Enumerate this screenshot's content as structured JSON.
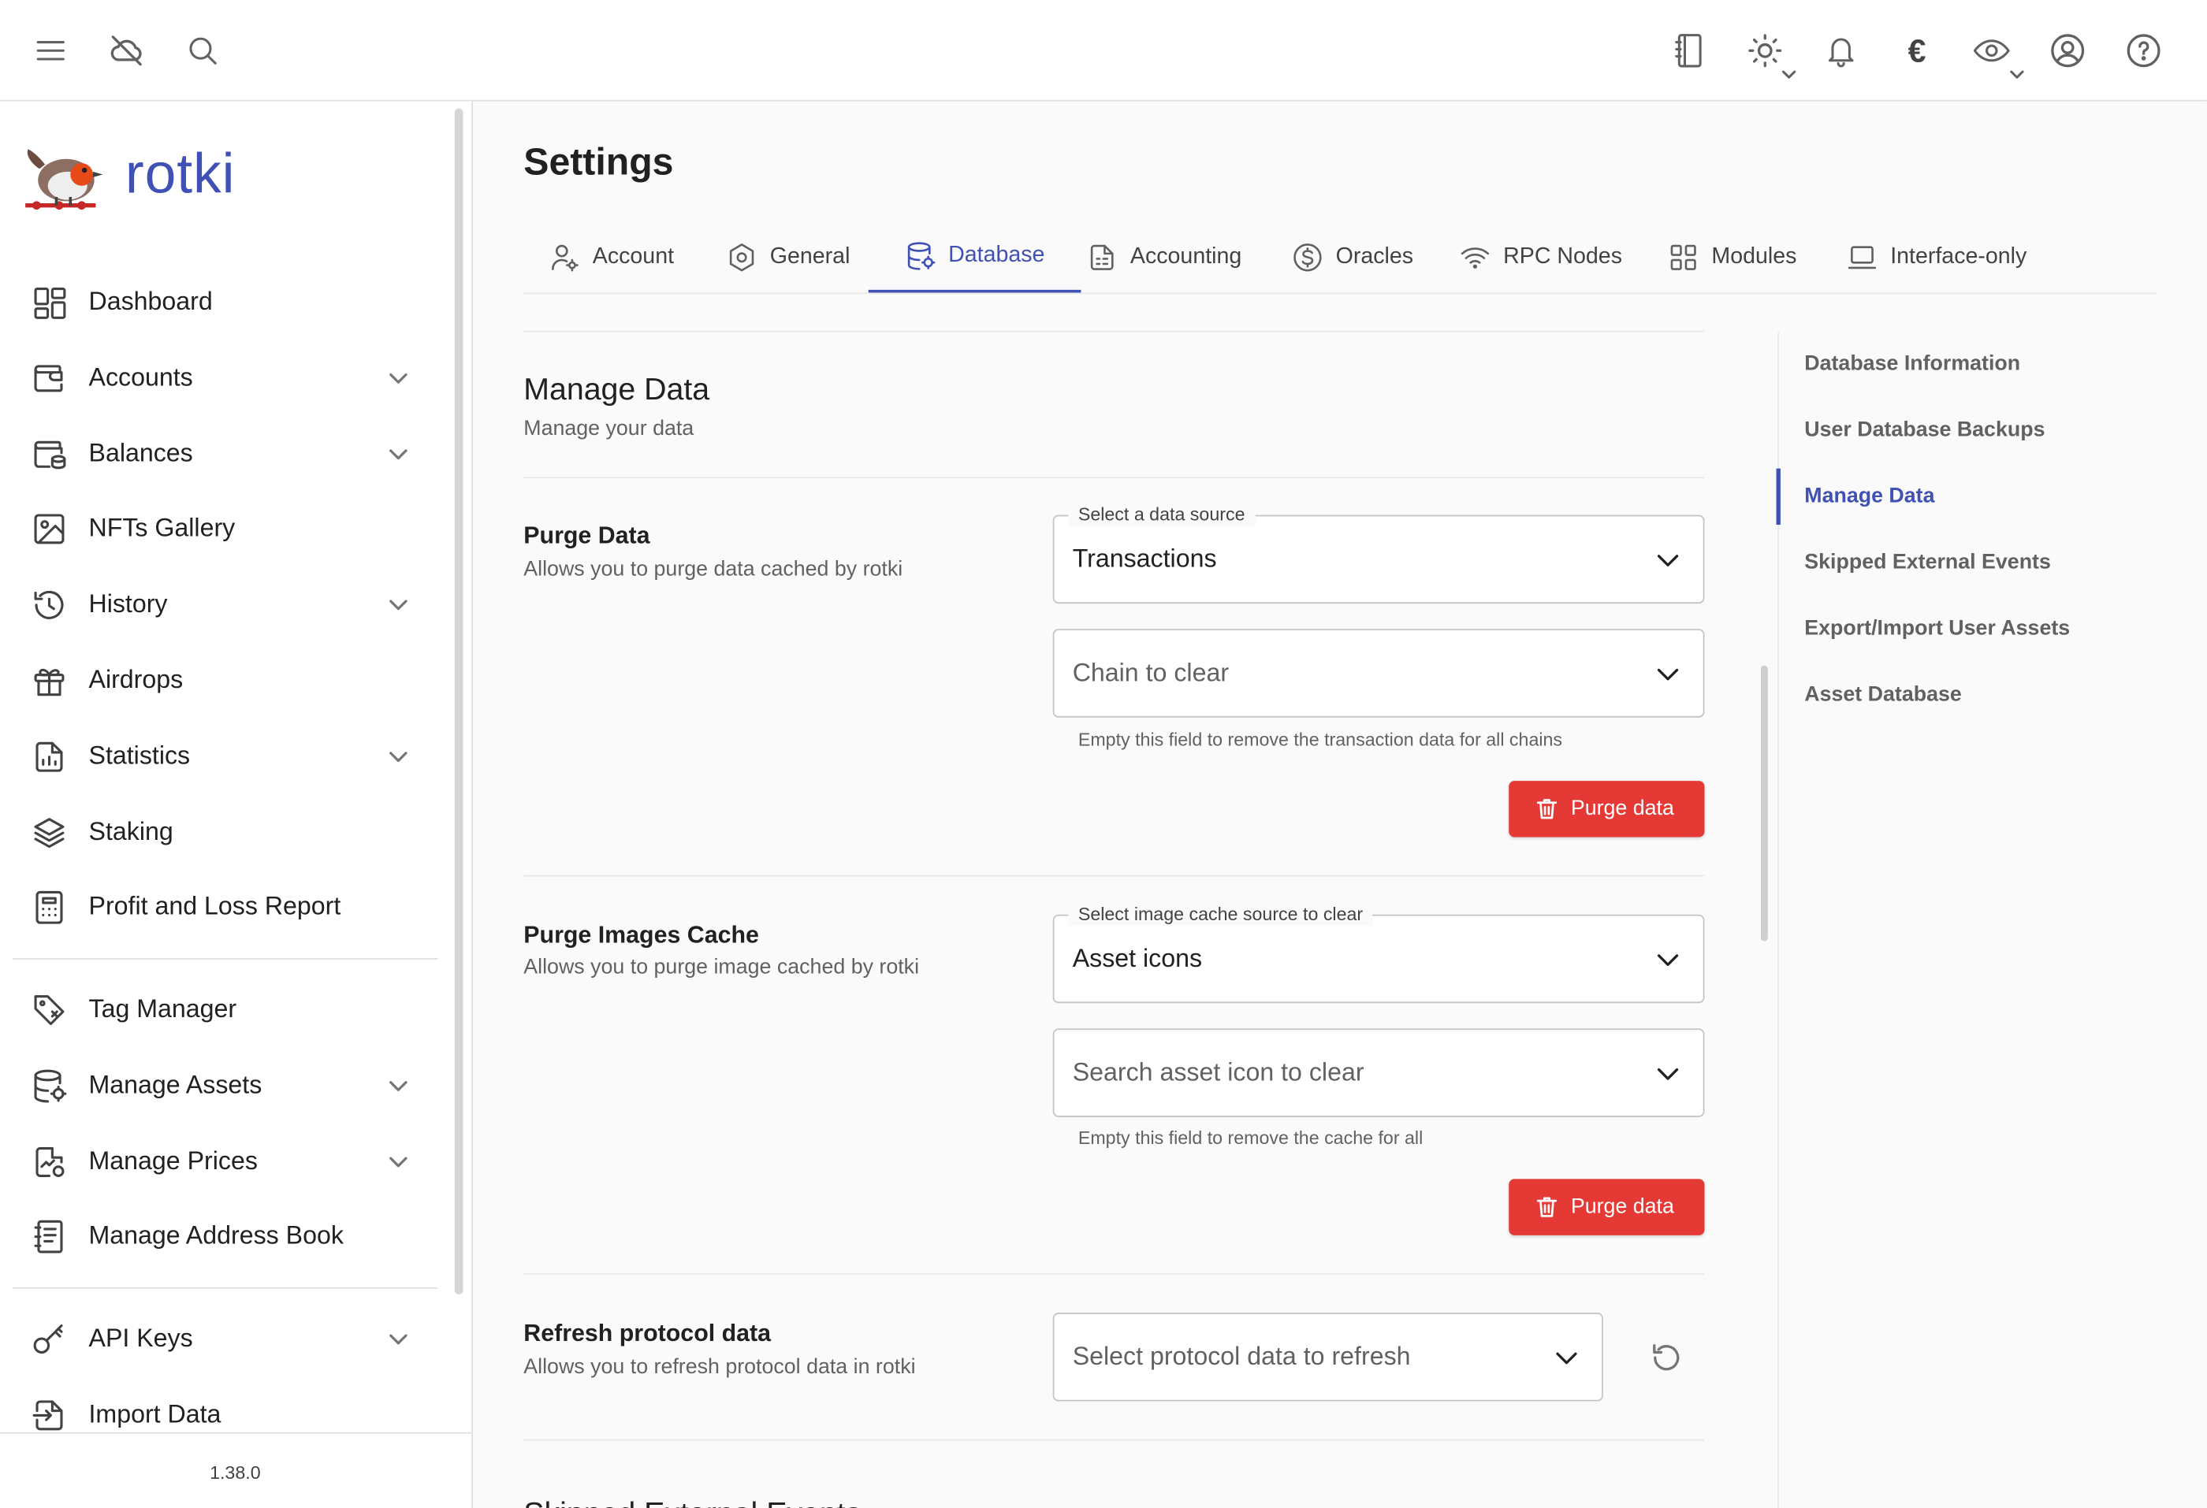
{
  "app": {
    "name": "rotki",
    "version": "1.38.0"
  },
  "colors": {
    "accent": "#3f51b5",
    "danger": "#e53935"
  },
  "topbar": {
    "left_icons": [
      "menu-icon",
      "cloud-off-icon",
      "search-icon"
    ],
    "right_icons": [
      "notes-icon",
      "theme-sun-icon",
      "notifications-bell-icon",
      "currency-euro-icon",
      "privacy-eye-icon",
      "user-account-icon",
      "help-icon"
    ],
    "currency_symbol": "€"
  },
  "sidebar": {
    "items": [
      {
        "label": "Dashboard",
        "icon": "dashboard-icon",
        "expandable": false
      },
      {
        "label": "Accounts",
        "icon": "wallet-icon",
        "expandable": true
      },
      {
        "label": "Balances",
        "icon": "balances-icon",
        "expandable": true
      },
      {
        "label": "NFTs Gallery",
        "icon": "image-icon",
        "expandable": false
      },
      {
        "label": "History",
        "icon": "history-icon",
        "expandable": true
      },
      {
        "label": "Airdrops",
        "icon": "gift-icon",
        "expandable": false
      },
      {
        "label": "Statistics",
        "icon": "statistics-icon",
        "expandable": true
      },
      {
        "label": "Staking",
        "icon": "stack-icon",
        "expandable": false
      },
      {
        "label": "Profit and Loss Report",
        "icon": "calculator-icon",
        "expandable": false
      }
    ],
    "items2": [
      {
        "label": "Tag Manager",
        "icon": "tag-icon",
        "expandable": false
      },
      {
        "label": "Manage Assets",
        "icon": "database-icon",
        "expandable": true
      },
      {
        "label": "Manage Prices",
        "icon": "price-chart-icon",
        "expandable": true
      },
      {
        "label": "Manage Address Book",
        "icon": "address-book-icon",
        "expandable": false
      }
    ],
    "items3": [
      {
        "label": "API Keys",
        "icon": "key-icon",
        "expandable": true
      },
      {
        "label": "Import Data",
        "icon": "import-icon",
        "expandable": false
      }
    ]
  },
  "page": {
    "title": "Settings",
    "tabs": [
      {
        "label": "Account",
        "icon": "account-settings-icon",
        "active": false
      },
      {
        "label": "General",
        "icon": "general-settings-icon",
        "active": false
      },
      {
        "label": "Database",
        "icon": "database-settings-icon",
        "active": true
      },
      {
        "label": "Accounting",
        "icon": "accounting-icon",
        "active": false
      },
      {
        "label": "Oracles",
        "icon": "oracle-dollar-icon",
        "active": false
      },
      {
        "label": "RPC Nodes",
        "icon": "wifi-icon",
        "active": false
      },
      {
        "label": "Modules",
        "icon": "modules-grid-icon",
        "active": false
      },
      {
        "label": "Interface-only",
        "icon": "laptop-icon",
        "active": false
      }
    ]
  },
  "manage_data": {
    "title": "Manage Data",
    "subtitle": "Manage your data",
    "purge_data": {
      "title": "Purge Data",
      "subtitle": "Allows you to purge data cached by rotki",
      "source_label": "Select a data source",
      "source_value": "Transactions",
      "chain_placeholder": "Chain to clear",
      "hint": "Empty this field to remove the transaction data for all chains",
      "button": "Purge data"
    },
    "purge_images": {
      "title": "Purge Images Cache",
      "subtitle": "Allows you to purge image cached by rotki",
      "source_label": "Select image cache source to clear",
      "source_value": "Asset icons",
      "search_placeholder": "Search asset icon to clear",
      "hint": "Empty this field to remove the cache for all",
      "button": "Purge data"
    },
    "refresh_protocol": {
      "title": "Refresh protocol data",
      "subtitle": "Allows you to refresh protocol data in rotki",
      "placeholder": "Select protocol data to refresh"
    },
    "next_section_title": "Skipped External Events"
  },
  "toc": {
    "items": [
      {
        "label": "Database Information",
        "active": false
      },
      {
        "label": "User Database Backups",
        "active": false
      },
      {
        "label": "Manage Data",
        "active": true
      },
      {
        "label": "Skipped External Events",
        "active": false
      },
      {
        "label": "Export/Import User Assets",
        "active": false
      },
      {
        "label": "Asset Database",
        "active": false
      }
    ]
  }
}
